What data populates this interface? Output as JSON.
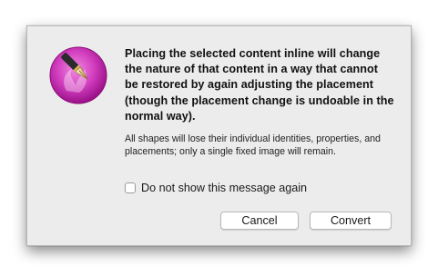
{
  "dialog": {
    "icon": "app-icon-pen-nib",
    "headline": "Placing the selected content inline will change the nature of that content in a way that cannot be restored by again adjusting the placement (though the placement change is undoable in the normal way).",
    "informative": "All shapes will lose their individual identities, properties, and placements; only a single fixed image will remain.",
    "checkbox": {
      "label": "Do not show this message again",
      "checked": false
    },
    "buttons": {
      "cancel": "Cancel",
      "convert": "Convert"
    }
  },
  "colors": {
    "icon_gradient_top": "#e35bd1",
    "icon_gradient_bottom": "#a0138f",
    "dialog_background": "#ececec"
  }
}
